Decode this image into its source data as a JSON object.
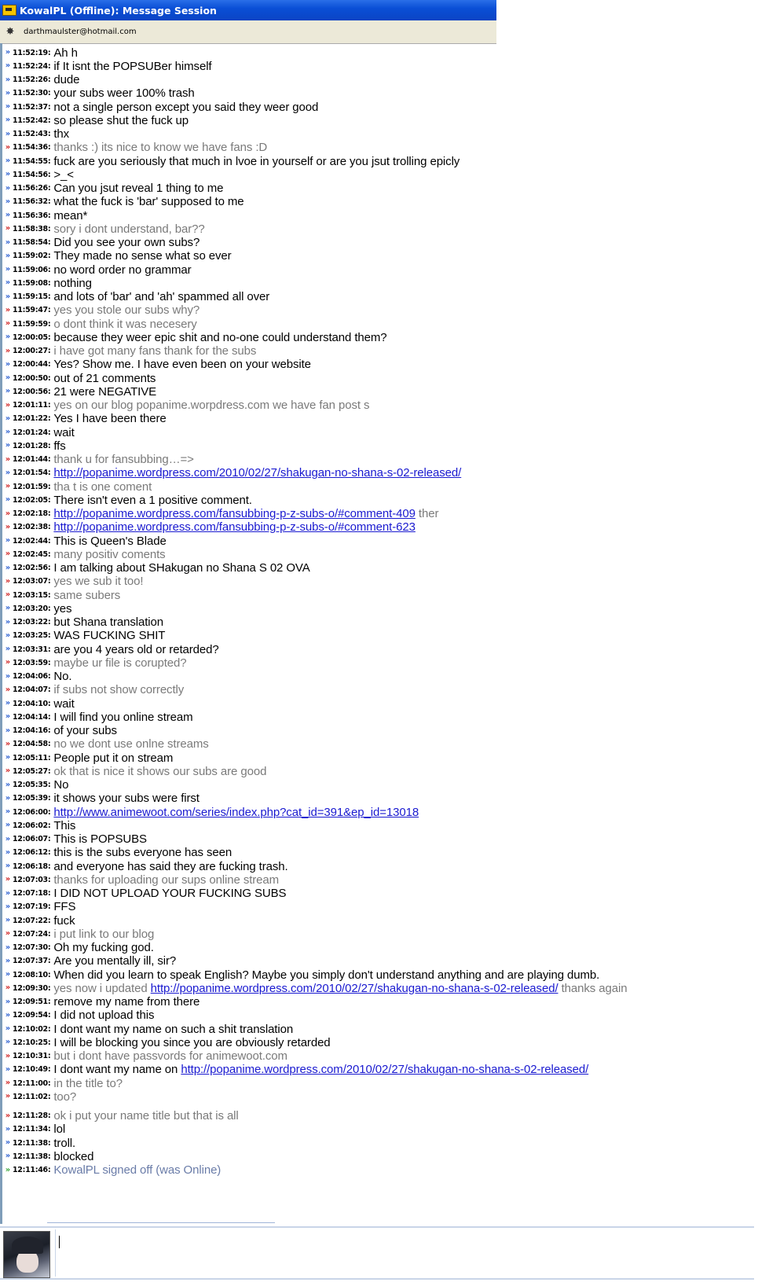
{
  "window": {
    "title": "KowalPL (Offline): Message Session",
    "contact": "darthmaulster@hotmail.com"
  },
  "messages": [
    {
      "ts": "11:52:19",
      "dir": "in",
      "text": "Ah h"
    },
    {
      "ts": "11:52:24",
      "dir": "in",
      "text": "if It isnt the POPSUBer himself"
    },
    {
      "ts": "11:52:26",
      "dir": "in",
      "text": "dude"
    },
    {
      "ts": "11:52:30",
      "dir": "in",
      "text": "your subs weer 100% trash"
    },
    {
      "ts": "11:52:37",
      "dir": "in",
      "text": "not a single person except you said they weer good"
    },
    {
      "ts": "11:52:42",
      "dir": "in",
      "text": "so please shut the fuck up"
    },
    {
      "ts": "11:52:43",
      "dir": "in",
      "text": "thx"
    },
    {
      "ts": "11:54:36",
      "dir": "out",
      "text": "thanks :) its nice to know we have fans :D"
    },
    {
      "ts": "11:54:55",
      "dir": "in",
      "text": "fuck are you seriously that much in lvoe in yourself or are you jsut trolling epicly"
    },
    {
      "ts": "11:54:56",
      "dir": "in",
      "text": ">_<"
    },
    {
      "ts": "11:56:26",
      "dir": "in",
      "text": "Can you jsut reveal 1 thing to me"
    },
    {
      "ts": "11:56:32",
      "dir": "in",
      "text": "what the fuck is 'bar' supposed to me"
    },
    {
      "ts": "11:56:36",
      "dir": "in",
      "text": "mean*"
    },
    {
      "ts": "11:58:38",
      "dir": "out",
      "text": "sory i dont understand, bar??"
    },
    {
      "ts": "11:58:54",
      "dir": "in",
      "text": "Did you see your own subs?"
    },
    {
      "ts": "11:59:02",
      "dir": "in",
      "text": "They made no sense what so ever"
    },
    {
      "ts": "11:59:06",
      "dir": "in",
      "text": "no word order no grammar"
    },
    {
      "ts": "11:59:08",
      "dir": "in",
      "text": "nothing"
    },
    {
      "ts": "11:59:15",
      "dir": "in",
      "text": "and lots of 'bar' and 'ah' spammed all over"
    },
    {
      "ts": "11:59:47",
      "dir": "out",
      "text": "yes you stole our subs why?"
    },
    {
      "ts": "11:59:59",
      "dir": "out",
      "text": "o dont think it was necesery"
    },
    {
      "ts": "12:00:05",
      "dir": "in",
      "text": "because they weer epic shit and no-one could understand them?"
    },
    {
      "ts": "12:00:27",
      "dir": "out",
      "text": "i have got many fans thank for the subs"
    },
    {
      "ts": "12:00:44",
      "dir": "in",
      "text": "Yes? Show me. I have even been on your website"
    },
    {
      "ts": "12:00:50",
      "dir": "in",
      "text": "out of 21 comments"
    },
    {
      "ts": "12:00:56",
      "dir": "in",
      "text": "21 were NEGATIVE"
    },
    {
      "ts": "12:01:11",
      "dir": "out",
      "text": "yes on our blog popanime.worpdress.com we have fan post s"
    },
    {
      "ts": "12:01:22",
      "dir": "in",
      "text": "Yes I have been there"
    },
    {
      "ts": "12:01:24",
      "dir": "in",
      "text": "wait"
    },
    {
      "ts": "12:01:28",
      "dir": "in",
      "text": "ffs"
    },
    {
      "ts": "12:01:44",
      "dir": "out",
      "text": "thank u for fansubbing…=>"
    },
    {
      "ts": "12:01:54",
      "dir": "in",
      "text": "",
      "link": "http://popanime.wordpress.com/2010/02/27/shakugan-no-shana-s-02-released/"
    },
    {
      "ts": "12:01:59",
      "dir": "out",
      "text": "tha t is one coment"
    },
    {
      "ts": "12:02:05",
      "dir": "in",
      "text": "There isn't even a 1 positive comment."
    },
    {
      "ts": "12:02:18",
      "dir": "out",
      "text": "",
      "link": "http://popanime.wordpress.com/fansubbing-p-z-subs-o/#comment-409",
      "after": " ther"
    },
    {
      "ts": "12:02:38",
      "dir": "out",
      "text": "",
      "link": "http://popanime.wordpress.com/fansubbing-p-z-subs-o/#comment-623"
    },
    {
      "ts": "12:02:44",
      "dir": "in",
      "text": "This is Queen's Blade"
    },
    {
      "ts": "12:02:45",
      "dir": "out",
      "text": "many positiv coments"
    },
    {
      "ts": "12:02:56",
      "dir": "in",
      "text": "I am talking about SHakugan no Shana S 02 OVA"
    },
    {
      "ts": "12:03:07",
      "dir": "out",
      "text": "yes we sub it too!"
    },
    {
      "ts": "12:03:15",
      "dir": "out",
      "text": "same subers"
    },
    {
      "ts": "12:03:20",
      "dir": "in",
      "text": "yes"
    },
    {
      "ts": "12:03:22",
      "dir": "in",
      "text": "but Shana translation"
    },
    {
      "ts": "12:03:25",
      "dir": "in",
      "text": "WAS FUCKING SHIT"
    },
    {
      "ts": "12:03:31",
      "dir": "in",
      "text": "are you 4 years old or retarded?"
    },
    {
      "ts": "12:03:59",
      "dir": "out",
      "text": "maybe ur file is corupted?"
    },
    {
      "ts": "12:04:06",
      "dir": "in",
      "text": "No."
    },
    {
      "ts": "12:04:07",
      "dir": "out",
      "text": "if subs not show correctly"
    },
    {
      "ts": "12:04:10",
      "dir": "in",
      "text": "wait"
    },
    {
      "ts": "12:04:14",
      "dir": "in",
      "text": "I will find you online stream"
    },
    {
      "ts": "12:04:16",
      "dir": "in",
      "text": "of your subs"
    },
    {
      "ts": "12:04:58",
      "dir": "out",
      "text": "no we dont use onlne streams"
    },
    {
      "ts": "12:05:11",
      "dir": "in",
      "text": "People put it on stream"
    },
    {
      "ts": "12:05:27",
      "dir": "out",
      "text": "ok that is nice it shows our subs are good"
    },
    {
      "ts": "12:05:35",
      "dir": "in",
      "text": "No"
    },
    {
      "ts": "12:05:39",
      "dir": "in",
      "text": "it shows your subs were first"
    },
    {
      "ts": "12:06:00",
      "dir": "in",
      "text": "",
      "link": "http://www.animewoot.com/series/index.php?cat_id=391&ep_id=13018"
    },
    {
      "ts": "12:06:02",
      "dir": "in",
      "text": "This"
    },
    {
      "ts": "12:06:07",
      "dir": "in",
      "text": "This is POPSUBS"
    },
    {
      "ts": "12:06:12",
      "dir": "in",
      "text": "this is the subs everyone has seen"
    },
    {
      "ts": "12:06:18",
      "dir": "in",
      "text": "and everyone has said they are fucking trash."
    },
    {
      "ts": "12:07:03",
      "dir": "out",
      "text": "thanks for uploading our sups online stream"
    },
    {
      "ts": "12:07:18",
      "dir": "in",
      "text": "I DID NOT UPLOAD YOUR FUCKING SUBS"
    },
    {
      "ts": "12:07:19",
      "dir": "in",
      "text": "FFS"
    },
    {
      "ts": "12:07:22",
      "dir": "in",
      "text": "fuck"
    },
    {
      "ts": "12:07:24",
      "dir": "out",
      "text": "i put link to our blog"
    },
    {
      "ts": "12:07:30",
      "dir": "in",
      "text": "Oh my fucking god."
    },
    {
      "ts": "12:07:37",
      "dir": "in",
      "text": "Are you mentally ill, sir?"
    },
    {
      "ts": "12:08:10",
      "dir": "in",
      "text": "When did you learn to speak English? Maybe you simply don't understand anything and are playing dumb."
    },
    {
      "ts": "12:09:30",
      "dir": "out",
      "text": "yes now i updated ",
      "link": "http://popanime.wordpress.com/2010/02/27/shakugan-no-shana-s-02-released/",
      "after": " thanks again"
    },
    {
      "ts": "12:09:51",
      "dir": "in",
      "text": "remove my name from there"
    },
    {
      "ts": "12:09:54",
      "dir": "in",
      "text": "I did not upload this"
    },
    {
      "ts": "12:10:02",
      "dir": "in",
      "text": "I dont want my name on such a shit translation"
    },
    {
      "ts": "12:10:25",
      "dir": "in",
      "text": "I will be blocking you since you are obviously retarded"
    },
    {
      "ts": "12:10:31",
      "dir": "out",
      "text": "but i dont have passvords for animewoot.com"
    },
    {
      "ts": "12:10:49",
      "dir": "in",
      "text": "I dont want my name on ",
      "link": "http://popanime.wordpress.com/2010/02/27/shakugan-no-shana-s-02-released/"
    },
    {
      "ts": "12:11:00",
      "dir": "out",
      "text": "in the title to?"
    },
    {
      "ts": "12:11:02",
      "dir": "out",
      "text": "too?"
    },
    {
      "ts": "12:11:28",
      "dir": "out",
      "text": "ok i put your name title but that is all"
    },
    {
      "ts": "12:11:34",
      "dir": "in",
      "text": "lol"
    },
    {
      "ts": "12:11:38",
      "dir": "in",
      "text": "troll."
    },
    {
      "ts": "12:11:38",
      "dir": "in",
      "text": "blocked"
    },
    {
      "ts": "12:11:46",
      "dir": "sys",
      "text": "KowalPL signed off (was Online)"
    }
  ],
  "composer": {
    "value": ""
  },
  "colors": {
    "incoming_arrow": "#2b5fd1",
    "outgoing_arrow": "#d02222",
    "system_arrow": "#3aa63a",
    "link": "#1a1ad0"
  }
}
